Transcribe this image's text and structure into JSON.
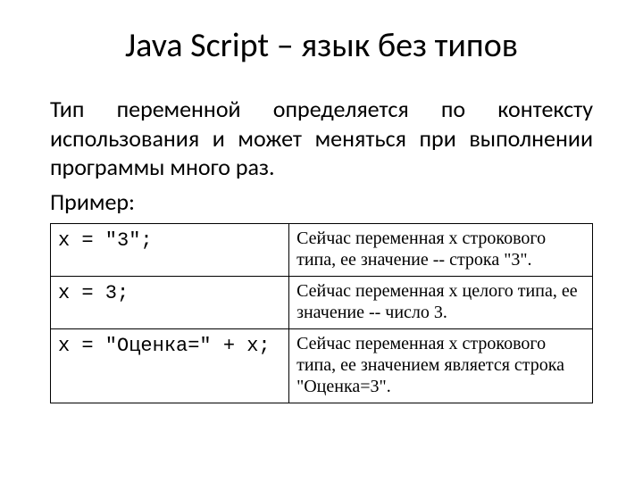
{
  "title": "Java Script – язык без типов",
  "paragraph": "Тип переменной определяется по контексту использования и может меняться при выполнении программы много раз.",
  "example_label": "Пример:",
  "rows": [
    {
      "code": "x = \"3\";",
      "desc": "Сейчас переменная x строкового типа, ее значение -- строка \"3\"."
    },
    {
      "code": "x = 3;",
      "desc": "Сейчас переменная x целого типа, ее значение -- число 3."
    },
    {
      "code": "x = \"Оценка=\" + x;",
      "desc": "Сейчас переменная x строкового типа, ее значением является строка \"Оценка=3\"."
    }
  ]
}
